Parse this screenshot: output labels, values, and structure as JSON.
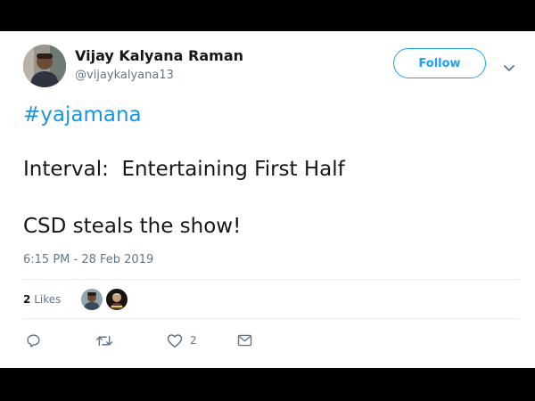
{
  "tweet": {
    "author_name": "Vijay Kalyana Raman",
    "author_handle": "@vijaykalyana13",
    "follow_label": "Follow",
    "hashtag": "#yajamana",
    "line1": "Interval:  Entertaining First Half",
    "line2": "CSD steals the show!",
    "timestamp": "6:15 PM - 28 Feb 2019",
    "likes_count": "2",
    "likes_label": "Likes",
    "like_action_count": "2"
  },
  "colors": {
    "accent": "#1da1f2",
    "hashtag": "#1b95e0",
    "text": "#14171a",
    "muted": "#657786",
    "divider": "#e6ecf0"
  },
  "icons": [
    "caret-down-icon",
    "reply-icon",
    "retweet-icon",
    "heart-icon",
    "mail-icon"
  ]
}
